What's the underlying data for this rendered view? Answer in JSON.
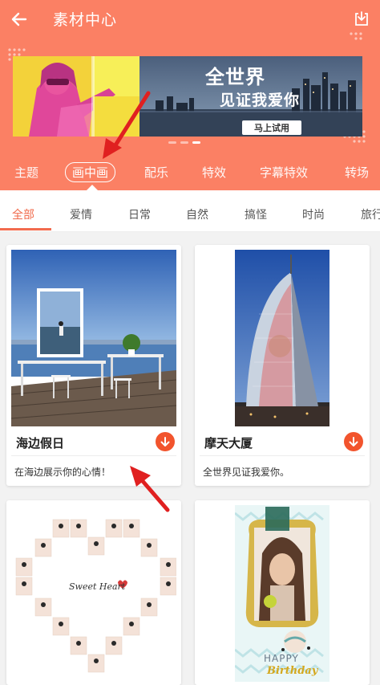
{
  "header": {
    "title": "素材中心",
    "back_icon": "back-arrow-icon",
    "download_icon": "download-box-icon",
    "background": "#fb8064"
  },
  "banner": {
    "headline_1": "全世界",
    "headline_2": "见证我爱你",
    "cta_label": "马上试用",
    "pages": 3,
    "active_page": 3
  },
  "categories": [
    {
      "label": "主题"
    },
    {
      "label": "画中画",
      "active": true
    },
    {
      "label": "配乐"
    },
    {
      "label": "特效"
    },
    {
      "label": "字幕特效"
    },
    {
      "label": "转场"
    }
  ],
  "subtabs": [
    {
      "label": "全部",
      "active": true
    },
    {
      "label": "爱情"
    },
    {
      "label": "日常"
    },
    {
      "label": "自然"
    },
    {
      "label": "搞怪"
    },
    {
      "label": "时尚"
    },
    {
      "label": "旅行"
    }
  ],
  "cards": [
    {
      "title": "海边假日",
      "desc": "在海边展示你的心情！",
      "download_icon": "download-circle-icon"
    },
    {
      "title": "摩天大厦",
      "desc": "全世界见证我爱你。",
      "download_icon": "download-circle-icon"
    },
    {
      "sticker_text": "Sweet Heart"
    },
    {
      "sticker_text_1": "HAPPY",
      "sticker_text_2": "Birthday"
    }
  ],
  "accent_color": "#f26b4e"
}
